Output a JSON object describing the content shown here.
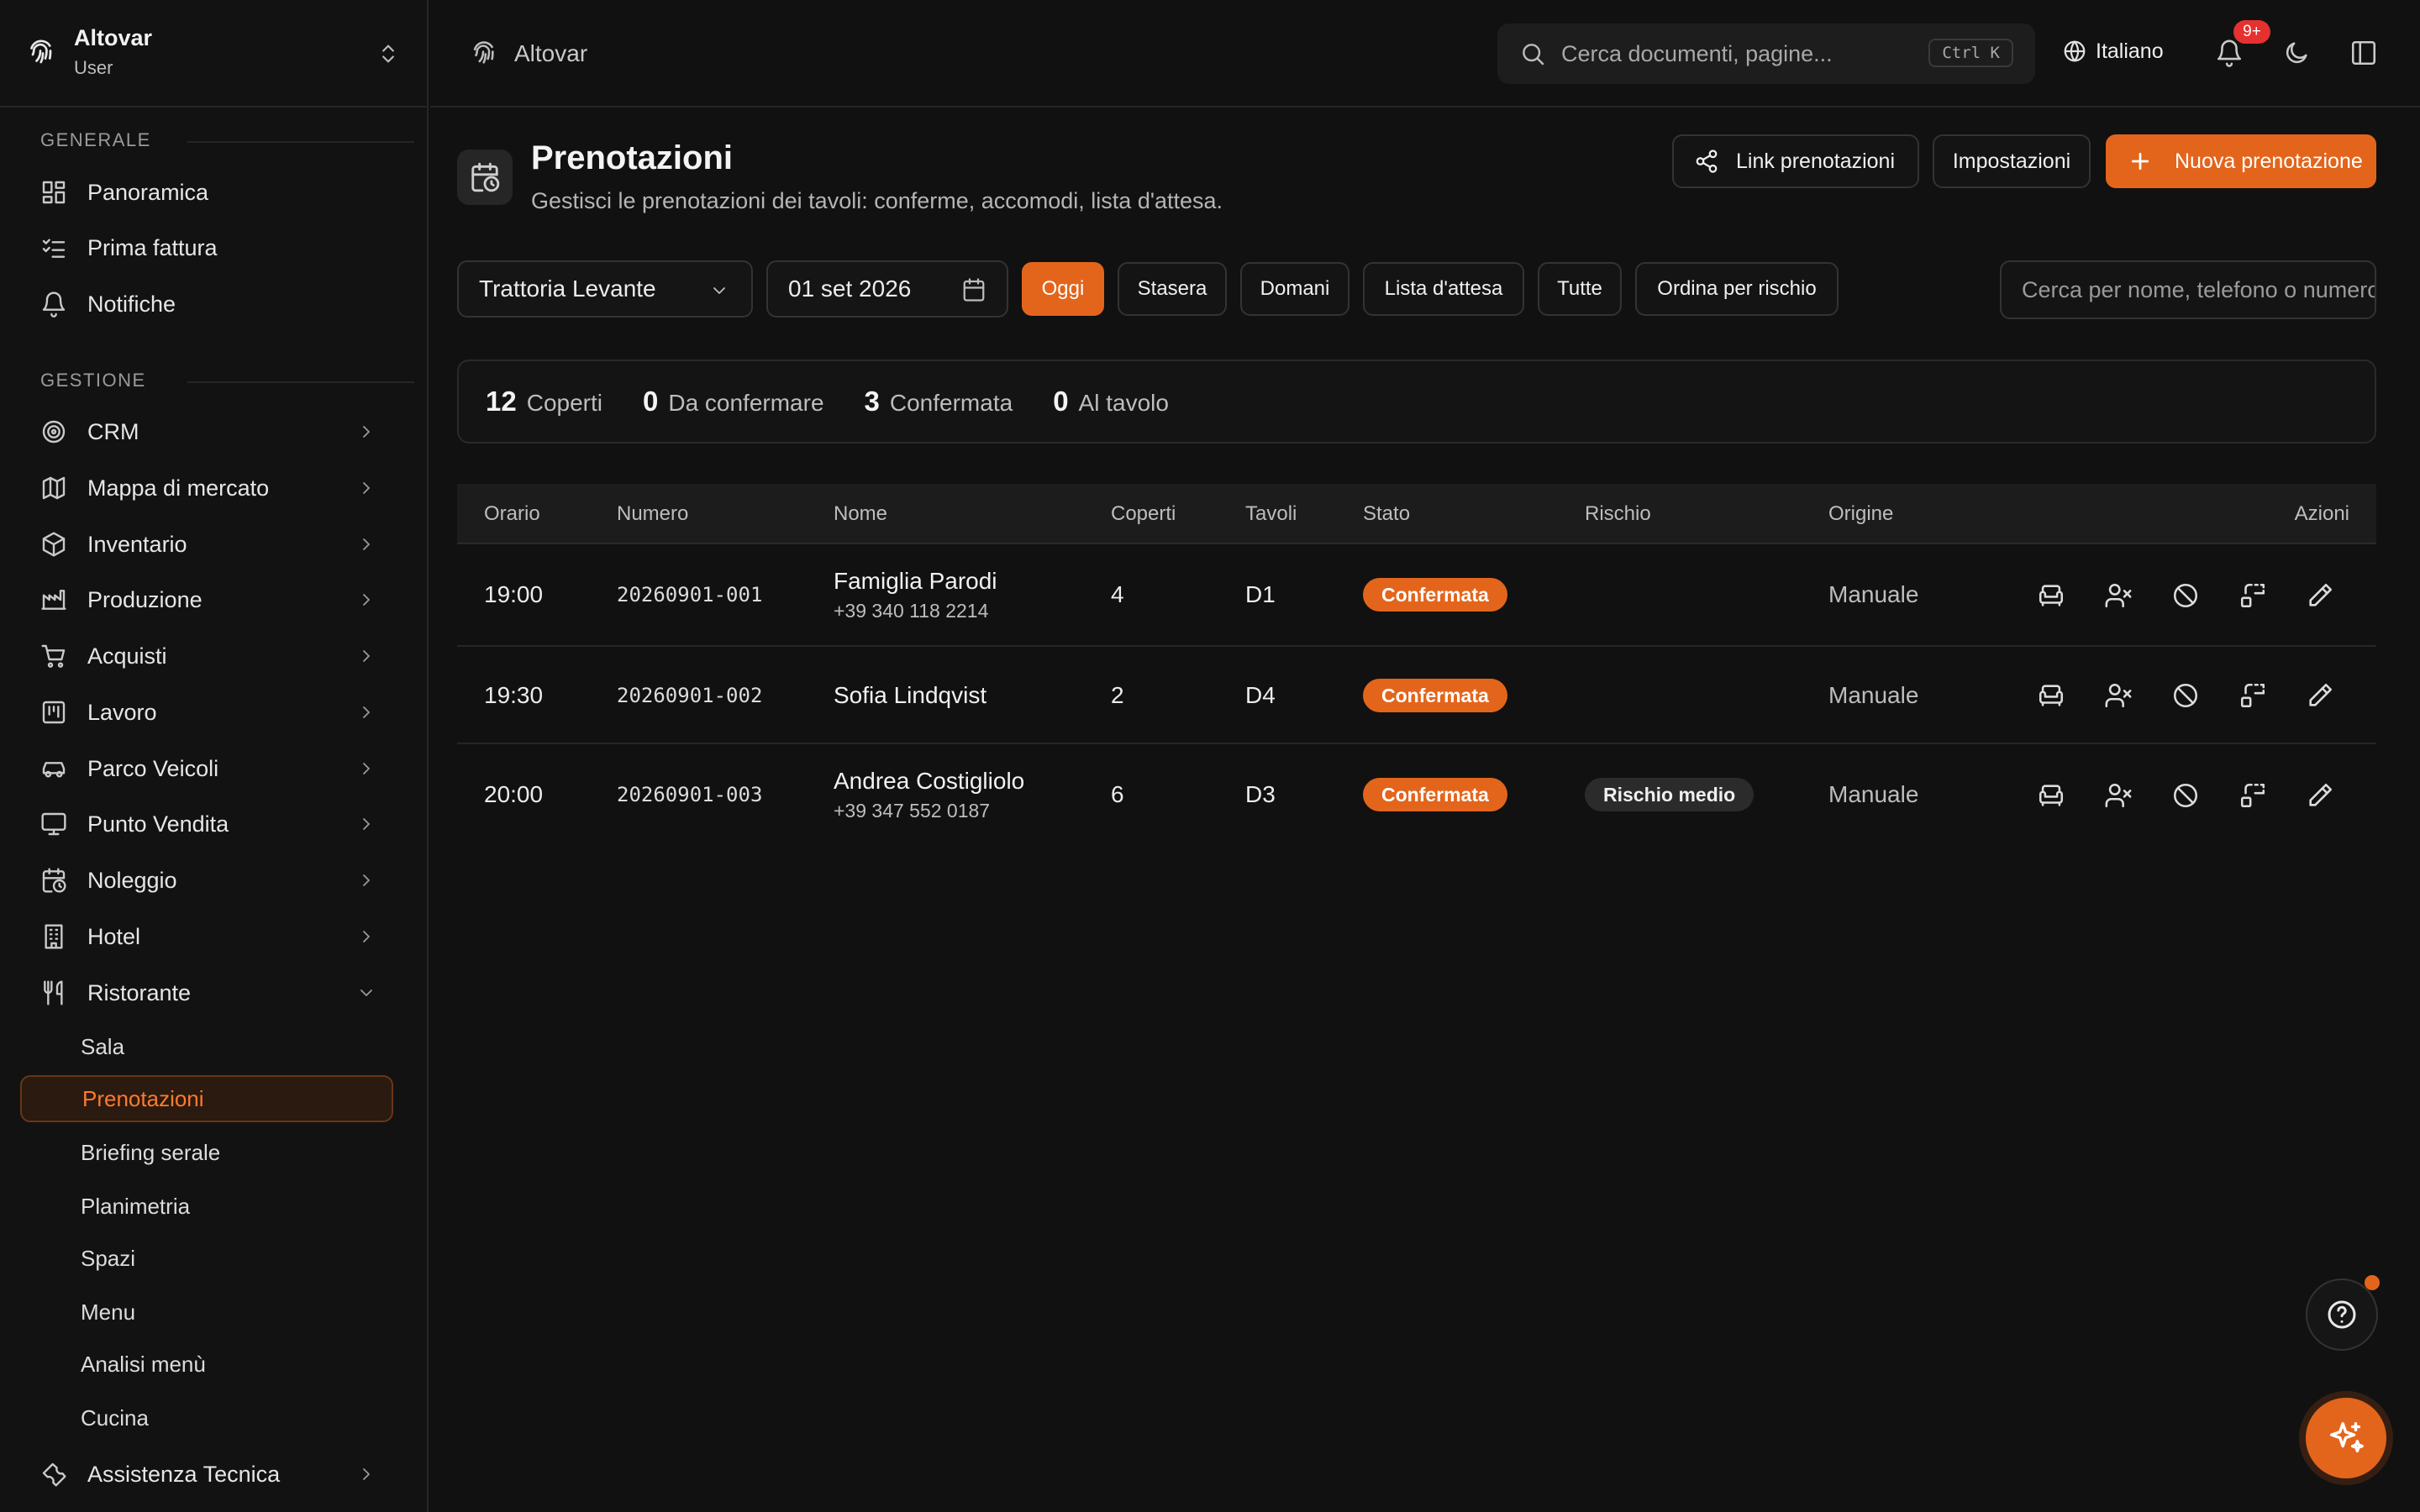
{
  "sidebar": {
    "org_name": "Altovar",
    "role": "User",
    "sections": {
      "general": "GENERALE",
      "management": "GESTIONE"
    },
    "general_items": [
      "Panoramica",
      "Prima fattura",
      "Notifiche"
    ],
    "management_items": [
      "CRM",
      "Mappa di mercato",
      "Inventario",
      "Produzione",
      "Acquisti",
      "Lavoro",
      "Parco Veicoli",
      "Punto Vendita",
      "Noleggio",
      "Hotel",
      "Ristorante"
    ],
    "ristorante_sub": [
      "Sala",
      "Prenotazioni",
      "Briefing serale",
      "Planimetria",
      "Spazi",
      "Menu",
      "Analisi menù",
      "Cucina"
    ],
    "last_item": "Assistenza Tecnica"
  },
  "topbar": {
    "breadcrumb": "Altovar",
    "search_placeholder": "Cerca documenti, pagine...",
    "search_shortcut": "Ctrl K",
    "language": "Italiano",
    "notification_badge": "9+"
  },
  "page": {
    "title": "Prenotazioni",
    "subtitle": "Gestisci le prenotazioni dei tavoli: conferme, accomodi, lista d'attesa.",
    "buttons": {
      "link": "Link prenotazioni",
      "settings": "Impostazioni",
      "new": "Nuova prenotazione"
    }
  },
  "filters": {
    "restaurant": "Trattoria Levante",
    "date": "01 set 2026",
    "chips": [
      "Oggi",
      "Stasera",
      "Domani",
      "Lista d'attesa",
      "Tutte",
      "Ordina per rischio"
    ],
    "active_chip": "Oggi",
    "search_placeholder": "Cerca per nome, telefono o numero"
  },
  "stats": [
    {
      "value": "12",
      "label": "Coperti"
    },
    {
      "value": "0",
      "label": "Da confermare"
    },
    {
      "value": "3",
      "label": "Confermata"
    },
    {
      "value": "0",
      "label": "Al tavolo"
    }
  ],
  "table": {
    "headers": [
      "Orario",
      "Numero",
      "Nome",
      "Coperti",
      "Tavoli",
      "Stato",
      "Rischio",
      "Origine",
      "Azioni"
    ],
    "rows": [
      {
        "time": "19:00",
        "number": "20260901-001",
        "name": "Famiglia Parodi",
        "phone": "+39 340 118 2214",
        "covers": "4",
        "table": "D1",
        "status": "Confermata",
        "risk": "",
        "origin": "Manuale"
      },
      {
        "time": "19:30",
        "number": "20260901-002",
        "name": "Sofia Lindqvist",
        "phone": "",
        "covers": "2",
        "table": "D4",
        "status": "Confermata",
        "risk": "",
        "origin": "Manuale"
      },
      {
        "time": "20:00",
        "number": "20260901-003",
        "name": "Andrea Costigliolo",
        "phone": "+39 347 552 0187",
        "covers": "6",
        "table": "D3",
        "status": "Confermata",
        "risk": "Rischio medio",
        "origin": "Manuale"
      }
    ]
  },
  "colors": {
    "accent": "#e3651c",
    "background": "#111111",
    "badge": "#e5312f"
  }
}
